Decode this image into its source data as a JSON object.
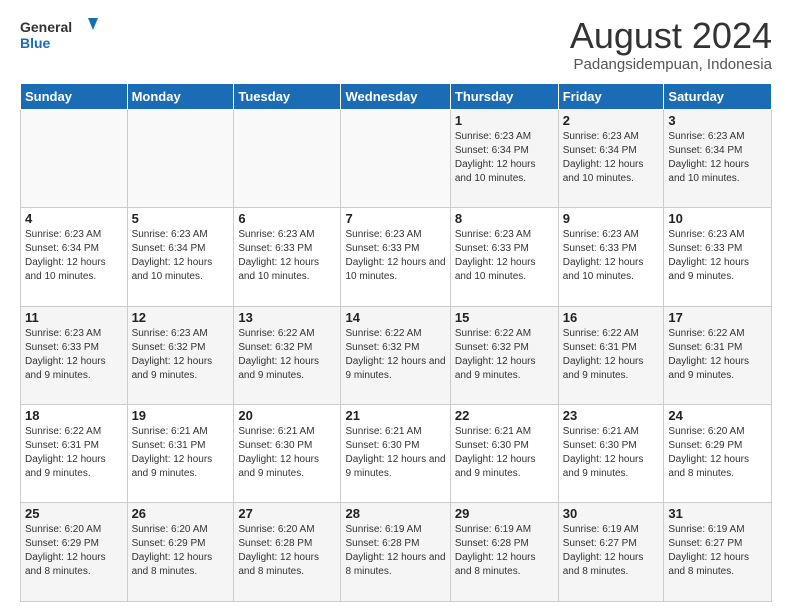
{
  "logo": {
    "line1": "General",
    "line2": "Blue"
  },
  "title": "August 2024",
  "subtitle": "Padangsidempuan, Indonesia",
  "weekdays": [
    "Sunday",
    "Monday",
    "Tuesday",
    "Wednesday",
    "Thursday",
    "Friday",
    "Saturday"
  ],
  "weeks": [
    [
      {
        "day": "",
        "info": ""
      },
      {
        "day": "",
        "info": ""
      },
      {
        "day": "",
        "info": ""
      },
      {
        "day": "",
        "info": ""
      },
      {
        "day": "1",
        "info": "Sunrise: 6:23 AM\nSunset: 6:34 PM\nDaylight: 12 hours and 10 minutes."
      },
      {
        "day": "2",
        "info": "Sunrise: 6:23 AM\nSunset: 6:34 PM\nDaylight: 12 hours and 10 minutes."
      },
      {
        "day": "3",
        "info": "Sunrise: 6:23 AM\nSunset: 6:34 PM\nDaylight: 12 hours and 10 minutes."
      }
    ],
    [
      {
        "day": "4",
        "info": "Sunrise: 6:23 AM\nSunset: 6:34 PM\nDaylight: 12 hours and 10 minutes."
      },
      {
        "day": "5",
        "info": "Sunrise: 6:23 AM\nSunset: 6:34 PM\nDaylight: 12 hours and 10 minutes."
      },
      {
        "day": "6",
        "info": "Sunrise: 6:23 AM\nSunset: 6:33 PM\nDaylight: 12 hours and 10 minutes."
      },
      {
        "day": "7",
        "info": "Sunrise: 6:23 AM\nSunset: 6:33 PM\nDaylight: 12 hours and 10 minutes."
      },
      {
        "day": "8",
        "info": "Sunrise: 6:23 AM\nSunset: 6:33 PM\nDaylight: 12 hours and 10 minutes."
      },
      {
        "day": "9",
        "info": "Sunrise: 6:23 AM\nSunset: 6:33 PM\nDaylight: 12 hours and 10 minutes."
      },
      {
        "day": "10",
        "info": "Sunrise: 6:23 AM\nSunset: 6:33 PM\nDaylight: 12 hours and 9 minutes."
      }
    ],
    [
      {
        "day": "11",
        "info": "Sunrise: 6:23 AM\nSunset: 6:33 PM\nDaylight: 12 hours and 9 minutes."
      },
      {
        "day": "12",
        "info": "Sunrise: 6:23 AM\nSunset: 6:32 PM\nDaylight: 12 hours and 9 minutes."
      },
      {
        "day": "13",
        "info": "Sunrise: 6:22 AM\nSunset: 6:32 PM\nDaylight: 12 hours and 9 minutes."
      },
      {
        "day": "14",
        "info": "Sunrise: 6:22 AM\nSunset: 6:32 PM\nDaylight: 12 hours and 9 minutes."
      },
      {
        "day": "15",
        "info": "Sunrise: 6:22 AM\nSunset: 6:32 PM\nDaylight: 12 hours and 9 minutes."
      },
      {
        "day": "16",
        "info": "Sunrise: 6:22 AM\nSunset: 6:31 PM\nDaylight: 12 hours and 9 minutes."
      },
      {
        "day": "17",
        "info": "Sunrise: 6:22 AM\nSunset: 6:31 PM\nDaylight: 12 hours and 9 minutes."
      }
    ],
    [
      {
        "day": "18",
        "info": "Sunrise: 6:22 AM\nSunset: 6:31 PM\nDaylight: 12 hours and 9 minutes."
      },
      {
        "day": "19",
        "info": "Sunrise: 6:21 AM\nSunset: 6:31 PM\nDaylight: 12 hours and 9 minutes."
      },
      {
        "day": "20",
        "info": "Sunrise: 6:21 AM\nSunset: 6:30 PM\nDaylight: 12 hours and 9 minutes."
      },
      {
        "day": "21",
        "info": "Sunrise: 6:21 AM\nSunset: 6:30 PM\nDaylight: 12 hours and 9 minutes."
      },
      {
        "day": "22",
        "info": "Sunrise: 6:21 AM\nSunset: 6:30 PM\nDaylight: 12 hours and 9 minutes."
      },
      {
        "day": "23",
        "info": "Sunrise: 6:21 AM\nSunset: 6:30 PM\nDaylight: 12 hours and 9 minutes."
      },
      {
        "day": "24",
        "info": "Sunrise: 6:20 AM\nSunset: 6:29 PM\nDaylight: 12 hours and 8 minutes."
      }
    ],
    [
      {
        "day": "25",
        "info": "Sunrise: 6:20 AM\nSunset: 6:29 PM\nDaylight: 12 hours and 8 minutes."
      },
      {
        "day": "26",
        "info": "Sunrise: 6:20 AM\nSunset: 6:29 PM\nDaylight: 12 hours and 8 minutes."
      },
      {
        "day": "27",
        "info": "Sunrise: 6:20 AM\nSunset: 6:28 PM\nDaylight: 12 hours and 8 minutes."
      },
      {
        "day": "28",
        "info": "Sunrise: 6:19 AM\nSunset: 6:28 PM\nDaylight: 12 hours and 8 minutes."
      },
      {
        "day": "29",
        "info": "Sunrise: 6:19 AM\nSunset: 6:28 PM\nDaylight: 12 hours and 8 minutes."
      },
      {
        "day": "30",
        "info": "Sunrise: 6:19 AM\nSunset: 6:27 PM\nDaylight: 12 hours and 8 minutes."
      },
      {
        "day": "31",
        "info": "Sunrise: 6:19 AM\nSunset: 6:27 PM\nDaylight: 12 hours and 8 minutes."
      }
    ]
  ]
}
